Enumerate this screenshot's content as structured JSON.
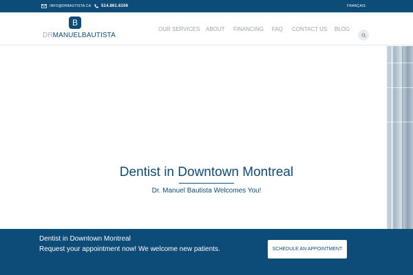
{
  "topbar": {
    "email": "INFO@DRBAUTISTA.CA",
    "phone": "514.861.6106",
    "language": "FRANÇAIS"
  },
  "logo": {
    "mark": "B",
    "prefix": "DR",
    "name": "MANUELBAUTISTA"
  },
  "nav": {
    "items": [
      {
        "label": "OUR SERVICES"
      },
      {
        "label": "ABOUT"
      },
      {
        "label": "FINANCING"
      },
      {
        "label": "FAQ"
      },
      {
        "label": "CONTACT US"
      },
      {
        "label": "BLOG"
      }
    ]
  },
  "hero": {
    "title": "Dentist in Downtown Montreal",
    "subtitle": "Dr. Manuel Bautista Welcomes You!"
  },
  "cta": {
    "title": "Dentist in Downtown Montreal",
    "text": "Request your appointment now! We welcome new patients.",
    "button_label": "SCHEDULE AN APPOINTMENT"
  },
  "colors": {
    "brand": "#0d4b78",
    "nav_text": "#9aa3ab",
    "logo_grey": "#a7adb3"
  },
  "icons": {
    "email": "envelope-icon",
    "phone": "phone-icon",
    "search": "search-icon"
  }
}
